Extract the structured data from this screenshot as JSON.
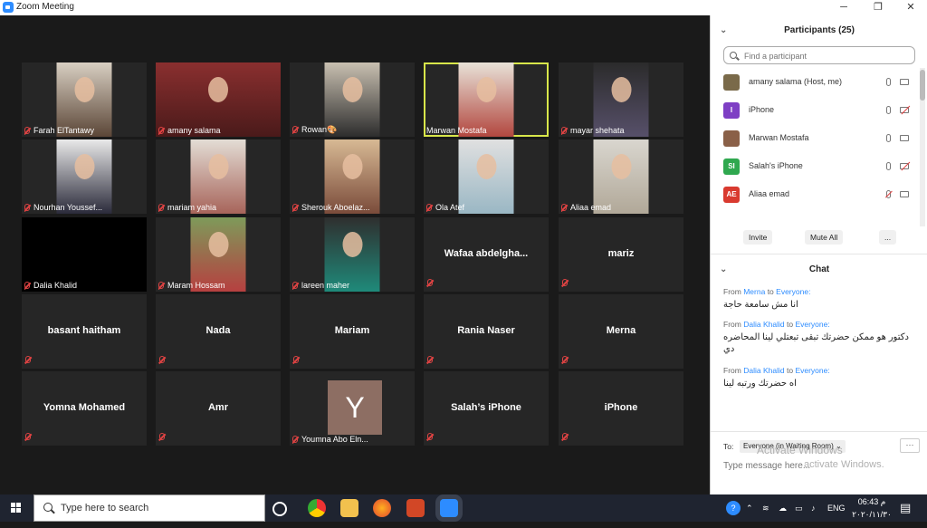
{
  "window": {
    "title": "Zoom Meeting",
    "minimize": "─",
    "maximize": "❐",
    "close": "✕"
  },
  "tiles": [
    {
      "name": "Farah ElTantawy",
      "kind": "video",
      "color": "c1"
    },
    {
      "name": "amany salama",
      "kind": "video",
      "color": "c2"
    },
    {
      "name": "Rowan🎨",
      "kind": "video",
      "color": "c3"
    },
    {
      "name": "Marwan Mostafa",
      "kind": "video",
      "color": "c4",
      "active": true,
      "muted": false
    },
    {
      "name": "mayar shehata",
      "kind": "video",
      "color": "c5"
    },
    {
      "name": "Nourhan Youssef...",
      "kind": "video",
      "color": "c6"
    },
    {
      "name": "mariam yahia",
      "kind": "video",
      "color": "c7"
    },
    {
      "name": "Sherouk Aboelaz...",
      "kind": "video",
      "color": "c8"
    },
    {
      "name": "Ola Atef",
      "kind": "video",
      "color": "c9"
    },
    {
      "name": "Aliaa emad",
      "kind": "video",
      "color": "c10"
    },
    {
      "name": "Dalia Khalid",
      "kind": "dark"
    },
    {
      "name": "Maram Hossam",
      "kind": "video",
      "color": "c11"
    },
    {
      "name": "lareen maher",
      "kind": "video",
      "color": "c12"
    },
    {
      "name": "Wafaa  abdelgha...",
      "kind": "text"
    },
    {
      "name": "mariz",
      "kind": "text"
    },
    {
      "name": "basant haitham",
      "kind": "text"
    },
    {
      "name": "Nada",
      "kind": "text"
    },
    {
      "name": "Mariam",
      "kind": "text"
    },
    {
      "name": "Rania Naser",
      "kind": "text"
    },
    {
      "name": "Merna",
      "kind": "text"
    },
    {
      "name": "Yomna Mohamed",
      "kind": "text"
    },
    {
      "name": "Amr",
      "kind": "text"
    },
    {
      "name": "Youmna Abo Eln...",
      "kind": "avatar",
      "letter": "Y"
    },
    {
      "name": "Salah’s iPhone",
      "kind": "text"
    },
    {
      "name": "iPhone",
      "kind": "text"
    }
  ],
  "participants": {
    "title": "Participants (25)",
    "search_placeholder": "Find a participant",
    "list": [
      {
        "name": "amany salama (Host, me)",
        "avatar": "",
        "avatar_color": "#7a6a4a",
        "mic_muted": false,
        "cam_off": false
      },
      {
        "name": "iPhone",
        "avatar": "I",
        "avatar_color": "#7e3fc4",
        "mic_muted": false,
        "cam_off": true
      },
      {
        "name": "Marwan Mostafa",
        "avatar": "",
        "avatar_color": "#8a6048",
        "mic_muted": false,
        "cam_off": false
      },
      {
        "name": "Salah's iPhone",
        "avatar": "SI",
        "avatar_color": "#2fa84f",
        "mic_muted": false,
        "cam_off": true
      },
      {
        "name": "Aliaa emad",
        "avatar": "AE",
        "avatar_color": "#d93a2f",
        "mic_muted": true,
        "cam_off": false
      }
    ],
    "invite": "Invite",
    "mute_all": "Mute All",
    "more": "..."
  },
  "chat": {
    "title": "Chat",
    "messages": [
      {
        "from_label": "From",
        "sender": "Merna",
        "to_label": "to",
        "recipient": "Everyone:",
        "text": "انا مش سامعة حاجة"
      },
      {
        "from_label": "From",
        "sender": "Dalia Khalid",
        "to_label": "to",
        "recipient": "Everyone:",
        "text": "دكتور هو ممكن حضرتك تبقى تبعتلي لينا المحاضره دي"
      },
      {
        "from_label": "From",
        "sender": "Dalia Khalid",
        "to_label": "to",
        "recipient": "Everyone:",
        "text": "اه حضرتك ورتبه لينا"
      }
    ],
    "to_label": "To:",
    "to_value": "Everyone (in Waiting Room) ⌄",
    "more": "···",
    "input_placeholder": "Type message here...",
    "watermark1": "Activate Windows",
    "watermark2": "activate Windows."
  },
  "taskbar": {
    "search_placeholder": "Type here to search",
    "lang": "ENG",
    "time": "06:43 م",
    "date": "٢٠٢٠/١١/٣٠"
  }
}
